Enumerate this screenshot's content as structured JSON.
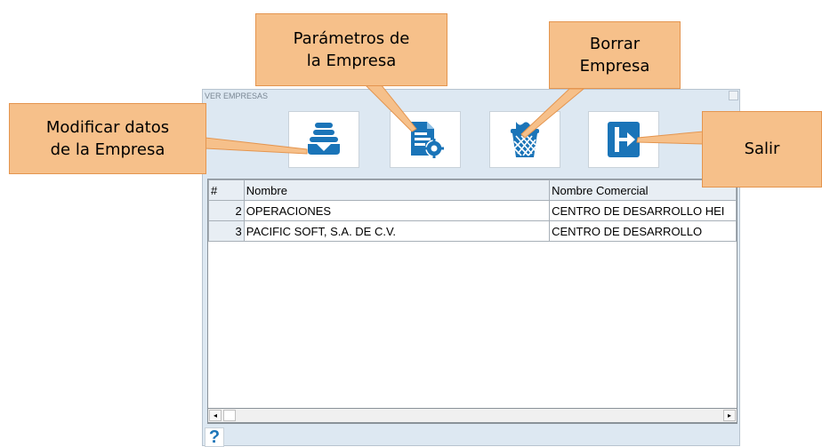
{
  "window": {
    "title": "VER EMPRESAS"
  },
  "toolbar": {
    "buttons": [
      {
        "icon": "download-stack-icon",
        "name": "modify-company-button"
      },
      {
        "icon": "document-gear-icon",
        "name": "company-parameters-button"
      },
      {
        "icon": "trash-bin-icon",
        "name": "delete-company-button"
      },
      {
        "icon": "exit-door-icon",
        "name": "exit-button"
      }
    ]
  },
  "grid": {
    "columns": [
      "#",
      "Nombre",
      "Nombre Comercial"
    ],
    "rows": [
      {
        "num": "2",
        "nombre": "OPERACIONES",
        "comercial": "CENTRO DE DESARROLLO HEI"
      },
      {
        "num": "3",
        "nombre": "PACIFIC SOFT, S.A. DE C.V.",
        "comercial": "CENTRO DE DESARROLLO"
      }
    ]
  },
  "scrollbar": {
    "left_arrow": "◂",
    "right_arrow": "▸"
  },
  "help": {
    "label": "?"
  },
  "callouts": {
    "modificar": "Modificar datos\nde la Empresa",
    "parametros": "Parámetros de\nla Empresa",
    "borrar": "Borrar\nEmpresa",
    "salir": "Salir"
  },
  "colors": {
    "accent": "#1a74b8",
    "callout_fill": "#f6c08a",
    "callout_border": "#e4954f",
    "window_bg": "#dde8f2"
  }
}
